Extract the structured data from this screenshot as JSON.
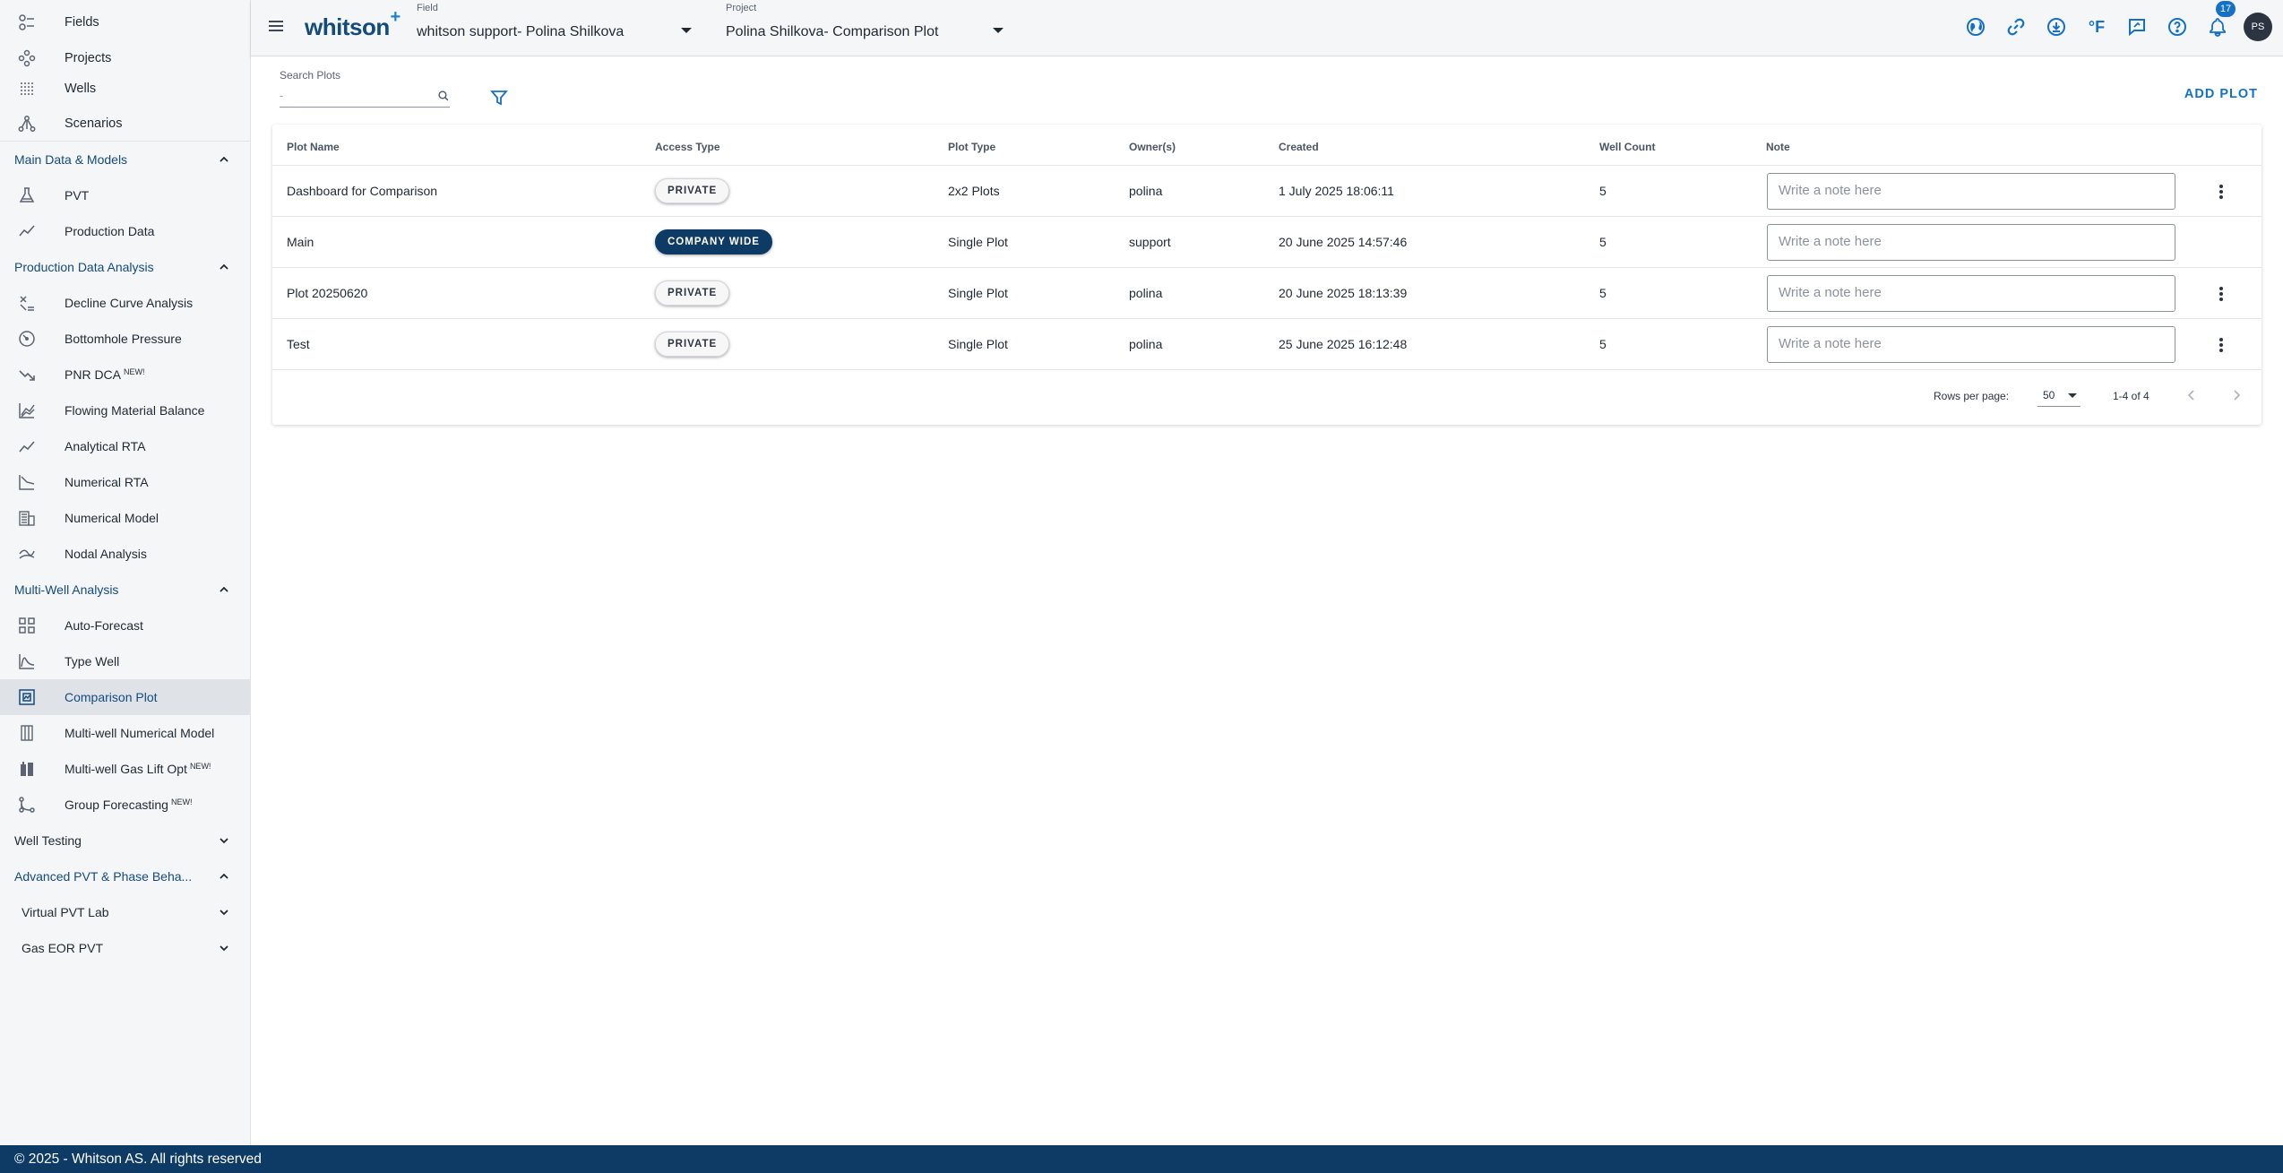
{
  "sidebar": {
    "top_items": [
      {
        "label": "Fields",
        "icon": "fields-icon"
      },
      {
        "label": "Projects",
        "icon": "projects-icon"
      },
      {
        "label": "Wells",
        "icon": "wells-icon"
      },
      {
        "label": "Scenarios",
        "icon": "scenarios-icon"
      }
    ],
    "main_data": {
      "title": "Main Data & Models",
      "items": [
        {
          "label": "PVT",
          "icon": "flask-icon"
        },
        {
          "label": "Production Data",
          "icon": "line-chart-icon"
        }
      ]
    },
    "production_analysis": {
      "title": "Production Data Analysis",
      "items": [
        {
          "label": "Decline Curve Analysis",
          "icon": "decline-curve-icon"
        },
        {
          "label": "Bottomhole Pressure",
          "icon": "gauge-icon"
        },
        {
          "label": "PNR DCA",
          "badge": "NEW!",
          "icon": "trending-down-icon"
        },
        {
          "label": "Flowing Material Balance",
          "icon": "multi-line-chart-icon"
        },
        {
          "label": "Analytical RTA",
          "icon": "show-chart-icon"
        },
        {
          "label": "Numerical RTA",
          "icon": "stacked-line-icon"
        },
        {
          "label": "Numerical Model",
          "icon": "grid-model-icon"
        },
        {
          "label": "Nodal Analysis",
          "icon": "nodal-icon"
        }
      ]
    },
    "multi_well": {
      "title": "Multi-Well Analysis",
      "items": [
        {
          "label": "Auto-Forecast",
          "icon": "grid-view-icon"
        },
        {
          "label": "Type Well",
          "icon": "type-well-icon"
        },
        {
          "label": "Comparison Plot",
          "icon": "comparison-plot-icon",
          "active": true
        },
        {
          "label": "Multi-well Numerical Model",
          "icon": "columns-icon"
        },
        {
          "label": "Multi-well Gas Lift Opt",
          "badge": "NEW!",
          "icon": "gas-lift-icon"
        },
        {
          "label": "Group Forecasting",
          "badge": "NEW!",
          "icon": "group-forecast-icon"
        }
      ]
    },
    "well_testing": {
      "title": "Well Testing"
    },
    "advanced_pvt": {
      "title": "Advanced PVT & Phase Beha...",
      "subsections": [
        {
          "title": "Virtual PVT Lab"
        },
        {
          "title": "Gas EOR PVT"
        }
      ]
    }
  },
  "header": {
    "brand": "whitson",
    "brand_plus": "+",
    "field": {
      "caption": "Field",
      "value": "whitson support- Polina Shilkova"
    },
    "project": {
      "caption": "Project",
      "value": "Polina Shilkova- Comparison Plot"
    },
    "notification_count": "17",
    "temperature_unit": "°F",
    "user_initials": "PS"
  },
  "toolbar": {
    "search_caption": "Search Plots",
    "search_placeholder": "-",
    "add_plot_label": "ADD PLOT"
  },
  "table": {
    "columns": [
      "Plot Name",
      "Access Type",
      "Plot Type",
      "Owner(s)",
      "Created",
      "Well Count",
      "Note"
    ],
    "note_placeholder": "Write a note here",
    "rows": [
      {
        "name": "Dashboard for Comparison",
        "access": "PRIVATE",
        "access_kind": "private",
        "type": "2x2 Plots",
        "owner": "polina",
        "created": "1 July 2025 18:06:11",
        "well_count": "5",
        "has_menu": true
      },
      {
        "name": "Main",
        "access": "COMPANY WIDE",
        "access_kind": "company",
        "type": "Single Plot",
        "owner": "support",
        "created": "20 June 2025 14:57:46",
        "well_count": "5",
        "has_menu": false
      },
      {
        "name": "Plot 20250620",
        "access": "PRIVATE",
        "access_kind": "private",
        "type": "Single Plot",
        "owner": "polina",
        "created": "20 June 2025 18:13:39",
        "well_count": "5",
        "has_menu": true
      },
      {
        "name": "Test",
        "access": "PRIVATE",
        "access_kind": "private",
        "type": "Single Plot",
        "owner": "polina",
        "created": "25 June 2025 16:12:48",
        "well_count": "5",
        "has_menu": true
      }
    ],
    "pagination": {
      "rows_per_page_label": "Rows per page:",
      "rows_per_page": "50",
      "range": "1-4 of 4"
    }
  },
  "footer": {
    "text": "© 2025 - Whitson AS. All rights reserved"
  },
  "colors": {
    "brand": "#134b7e",
    "accent": "#1571c7",
    "footer": "#0d3b66",
    "chip_company": "#0d3b66"
  }
}
